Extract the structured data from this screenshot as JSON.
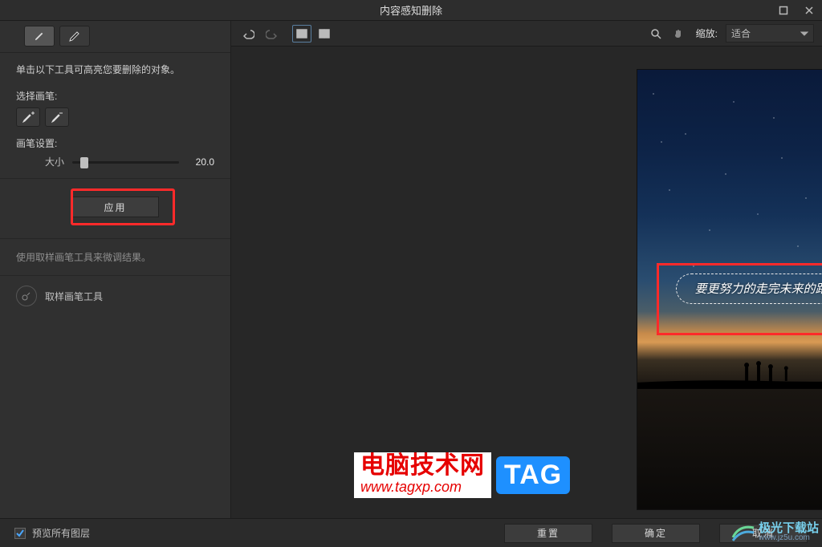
{
  "window": {
    "title": "内容感知删除"
  },
  "sidebar": {
    "instruction": "单击以下工具可高亮您要删除的对象。",
    "brush_label": "选择画笔:",
    "settings_label": "画笔设置:",
    "size_label": "大小",
    "size_value": "20.0",
    "apply_label": "应用",
    "hint": "使用取样画笔工具来微调结果。",
    "sample_tool_label": "取样画笔工具"
  },
  "canvas_toolbar": {
    "zoom_label": "缩放:",
    "zoom_value": "适合"
  },
  "image": {
    "overlay_text": "要更努力的走完未来的路"
  },
  "bottom": {
    "preview_all_layers": "预览所有图层",
    "reset": "重置",
    "ok": "确定",
    "cancel": "取消"
  },
  "watermark1": {
    "cn": "电脑技术网",
    "url": "www.tagxp.com",
    "tag": "TAG"
  },
  "watermark2": {
    "name": "极光下载站",
    "url": "www.jz5u.com"
  }
}
